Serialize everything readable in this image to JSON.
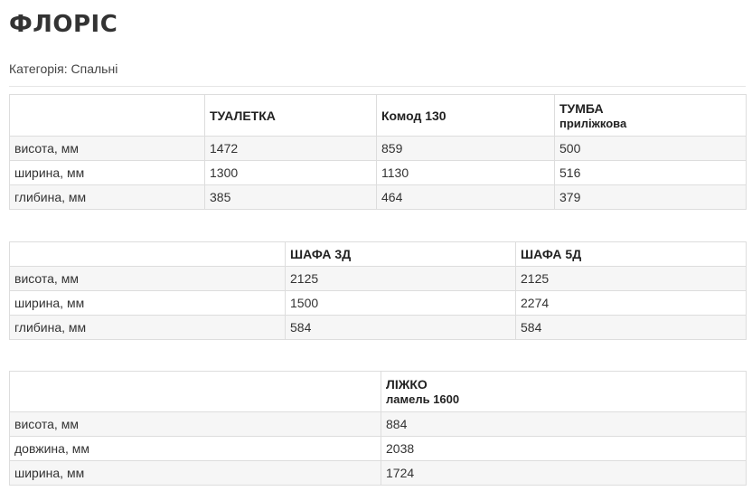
{
  "page": {
    "title": "ФЛОРІС",
    "category_label": "Категорія:",
    "category_value": "Спальні"
  },
  "table1": {
    "headers": [
      "",
      "ТУАЛЕТКА",
      "Комод 130",
      "ТУМБА"
    ],
    "header_sub": [
      "",
      "",
      "",
      "приліжкова"
    ],
    "rows": [
      [
        "висота, мм",
        "1472",
        "859",
        "500"
      ],
      [
        "ширина, мм",
        "1300",
        "1130",
        "516"
      ],
      [
        "глибина, мм",
        "385",
        "464",
        "379"
      ]
    ]
  },
  "table2": {
    "headers": [
      "",
      "ШАФА 3Д",
      "ШАФА 5Д"
    ],
    "rows": [
      [
        "висота, мм",
        "2125",
        "2125"
      ],
      [
        "ширина, мм",
        "1500",
        "2274"
      ],
      [
        "глибина, мм",
        "584",
        "584"
      ]
    ]
  },
  "table3": {
    "headers": [
      "",
      "ЛІЖКО"
    ],
    "header_sub": [
      "",
      "ламель 1600"
    ],
    "rows": [
      [
        "висота, мм",
        "884"
      ],
      [
        "довжина, мм",
        "2038"
      ],
      [
        "ширина, мм",
        "1724"
      ]
    ]
  }
}
